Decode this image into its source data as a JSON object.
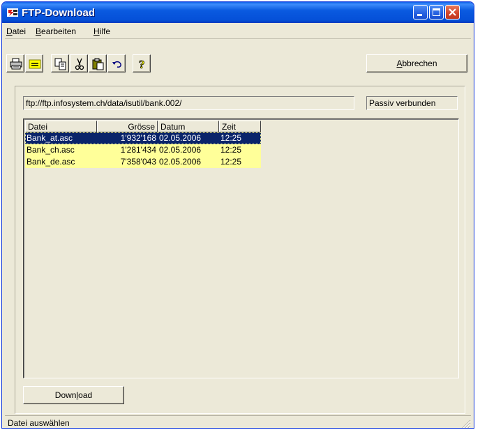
{
  "window": {
    "title": "FTP-Download",
    "icons": {
      "app": "ftp-app-icon",
      "minimize": "minimize-icon",
      "maximize": "maximize-icon",
      "close": "close-icon"
    }
  },
  "menu": {
    "items": [
      {
        "label": "Datei",
        "accel": "D",
        "rest": "atei"
      },
      {
        "label": "Bearbeiten",
        "accel": "B",
        "rest": "earbeiten"
      },
      {
        "label": "Hilfe",
        "accel": "H",
        "rest": "ilfe"
      }
    ]
  },
  "toolbar": {
    "tools": [
      {
        "name": "print-button",
        "icon": "printer-icon"
      },
      {
        "name": "note-button",
        "icon": "note-icon"
      },
      {
        "name": "copy-button",
        "icon": "copy-icon"
      },
      {
        "name": "cut-button",
        "icon": "scissors-icon"
      },
      {
        "name": "paste-button",
        "icon": "paste-icon"
      },
      {
        "name": "undo-button",
        "icon": "undo-icon"
      },
      {
        "name": "help-button",
        "icon": "help-icon"
      }
    ],
    "cancel_label_accel": "A",
    "cancel_label_rest": "bbrechen"
  },
  "connection": {
    "url": "ftp://ftp.infosystem.ch/data/isutil/bank.002/",
    "status": "Passiv verbunden"
  },
  "file_list": {
    "columns": [
      "Datei",
      "Grösse",
      "Datum",
      "Zeit"
    ],
    "rows": [
      {
        "name": "Bank_at.asc",
        "size": "1'932'168",
        "date": "02.05.2006",
        "time": "12:25",
        "selected": true
      },
      {
        "name": "Bank_ch.asc",
        "size": "1'281'434",
        "date": "02.05.2006",
        "time": "12:25",
        "selected": false
      },
      {
        "name": "Bank_de.asc",
        "size": "7'358'043",
        "date": "02.05.2006",
        "time": "12:25",
        "selected": false
      }
    ]
  },
  "download": {
    "label_pre": "Down",
    "label_accel": "l",
    "label_post": "oad"
  },
  "statusbar": {
    "text": "Datei auswählen"
  },
  "colors": {
    "row_highlight": "#ffff99",
    "selection": "#0a246a",
    "face": "#ece9d8"
  }
}
